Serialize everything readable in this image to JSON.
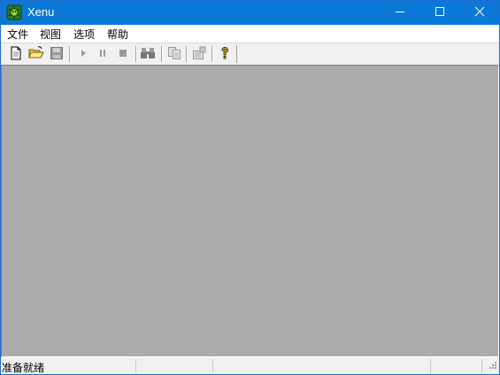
{
  "window": {
    "title": "Xenu",
    "app_icon": "xenu-spider-icon",
    "controls": [
      "minimize-icon",
      "maximize-icon",
      "close-icon"
    ]
  },
  "menu": {
    "items": [
      {
        "label": "文件"
      },
      {
        "label": "视图"
      },
      {
        "label": "选项"
      },
      {
        "label": "帮助"
      }
    ]
  },
  "toolbar": {
    "buttons": [
      {
        "icon": "new-document-icon",
        "enabled": true
      },
      {
        "icon": "open-folder-icon",
        "enabled": true
      },
      {
        "icon": "save-icon",
        "enabled": false
      },
      {
        "icon": "play-icon",
        "enabled": false
      },
      {
        "icon": "pause-icon",
        "enabled": false
      },
      {
        "icon": "stop-icon",
        "enabled": false
      },
      {
        "icon": "find-binoculars-icon",
        "enabled": false
      },
      {
        "icon": "copy-icon",
        "enabled": false
      },
      {
        "icon": "properties-icon",
        "enabled": false
      },
      {
        "icon": "help-icon",
        "enabled": true
      }
    ]
  },
  "statusbar": {
    "text": "准备就绪"
  },
  "colors": {
    "titlebar": "#0b78d7",
    "client_area": "#ababab",
    "chrome": "#f0f0f0"
  }
}
